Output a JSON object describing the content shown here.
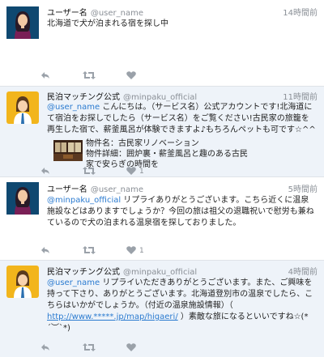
{
  "colors": {
    "mention": "#2b7bd0",
    "meta": "#8a8f96",
    "highlight_bg": "#eef3f9"
  },
  "tweets": [
    {
      "name": "ユーザー名",
      "handle": "@user_name",
      "time": "14時間前",
      "text": "北海道で犬が泊まれる宿を探し中",
      "likes": ""
    },
    {
      "name": "民泊マッチング公式",
      "handle": "@minpaku_official",
      "time": "11時間前",
      "mention": "@user_name",
      "text": " こんにちは。（サービス名）公式アカウントです!北海道にて宿泊をお探しでしたら（サービス名）をご覧ください!古民家の旅籠を再生した宿で、薪釜風呂が体験できますよ♪もちろんペットも可です☆^^",
      "card": {
        "title": "物件名：古民家リノベーション",
        "detail": "物件詳細：囲炉裏・薪釜風呂と趣のある古民家で安らぎの時間を"
      },
      "likes": "1"
    },
    {
      "name": "ユーザー名",
      "handle": "@user_name",
      "time": "5時間前",
      "mention": "@minpaku_official",
      "text": " リプライありがとうございます。こちら近くに温泉施設などはありますでしょうか？今回の旅は祖父の退職祝いで慰労も兼ねているので犬の泊まれる温泉宿を探しておりました。",
      "likes": "1"
    },
    {
      "name": "民泊マッチング公式",
      "handle": "@minpaku_official",
      "time": "4時間前",
      "mention": "@user_name",
      "text_before": " リプライいただきありがとうございます。また、ご興味を持って下さり、ありがとうございます。北海道登別市の温泉でしたら、こちらはいかがでしょうか。（付近の温泉施設情報）（ ",
      "link": "http://www.*****.jp/map/higaeri/",
      "text_after": " ）素敵な旅になるといいですね☆(*´︶`*)",
      "likes": ""
    }
  ],
  "icons": [
    "reply-icon",
    "retweet-icon",
    "like-icon"
  ]
}
